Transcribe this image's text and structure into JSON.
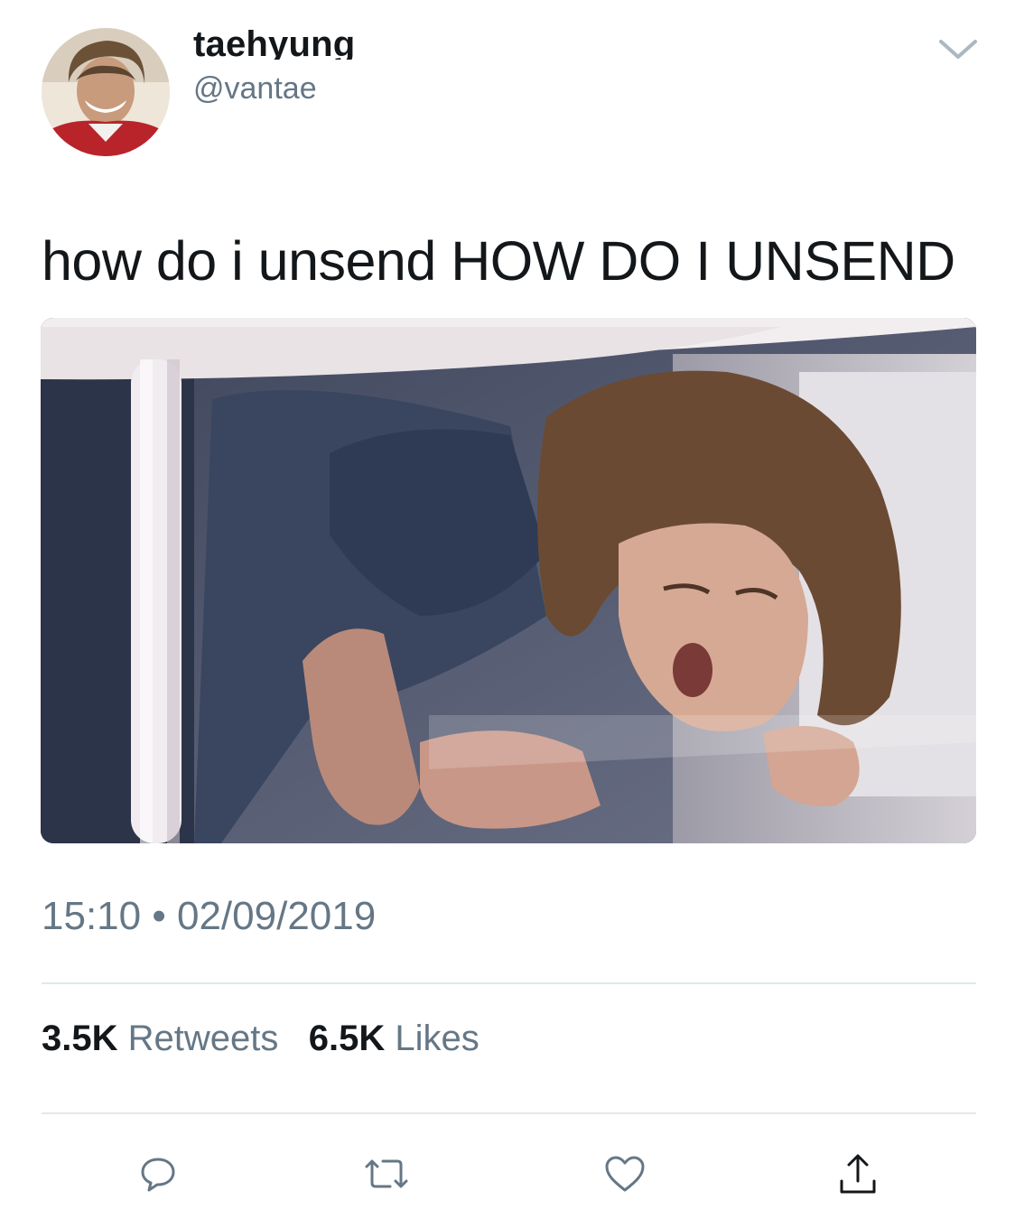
{
  "author": {
    "display_name": "taehyung",
    "handle": "@vantae"
  },
  "tweet": {
    "text": "how do i unsend HOW DO I UNSEND",
    "time": "15:10",
    "separator": "•",
    "date": "02/09/2019"
  },
  "stats": {
    "retweets_count": "3.5K",
    "retweets_label": "Retweets",
    "likes_count": "6.5K",
    "likes_label": "Likes"
  },
  "icons": {
    "caret": "chevron-down-icon",
    "reply": "reply-icon",
    "retweet": "retweet-icon",
    "like": "heart-icon",
    "share": "share-icon"
  },
  "colors": {
    "primary_text": "#14171a",
    "secondary_text": "#657786",
    "divider": "#e1e8ed",
    "icon": "#657786"
  }
}
